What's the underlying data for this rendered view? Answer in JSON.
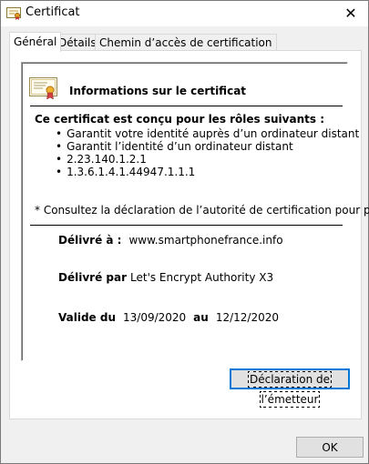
{
  "window": {
    "title": "Certificat",
    "close_glyph": "✕"
  },
  "tabs": [
    {
      "label": "Général",
      "active": true
    },
    {
      "label": "Détails",
      "active": false
    },
    {
      "label": "Chemin d’accès de certification",
      "active": false
    }
  ],
  "general": {
    "info_title": "Informations sur le certificat",
    "roles_heading": "Ce certificat est conçu pour les rôles suivants :",
    "roles": [
      "Garantit votre identité auprès d’un ordinateur distant",
      "Garantit l’identité d’un ordinateur distant",
      "2.23.140.1.2.1",
      "1.3.6.1.4.1.44947.1.1.1"
    ],
    "note": "* Consultez la déclaration de l’autorité de certification pour plu",
    "issued_to_label": "Délivré à :",
    "issued_to_value": "www.smartphonefrance.info",
    "issued_by_label": "Délivré par",
    "issued_by_value": "Let's Encrypt Authority X3",
    "valid_from_label": "Valide du",
    "valid_from_value": "13/09/2020",
    "valid_to_label": "au",
    "valid_to_value": "12/12/2020"
  },
  "buttons": {
    "issuer_statement": "Déclaration de l’émetteur",
    "ok": "OK"
  },
  "icons": {
    "title_icon": "certificate-icon",
    "cert_icon": "certificate-icon"
  }
}
